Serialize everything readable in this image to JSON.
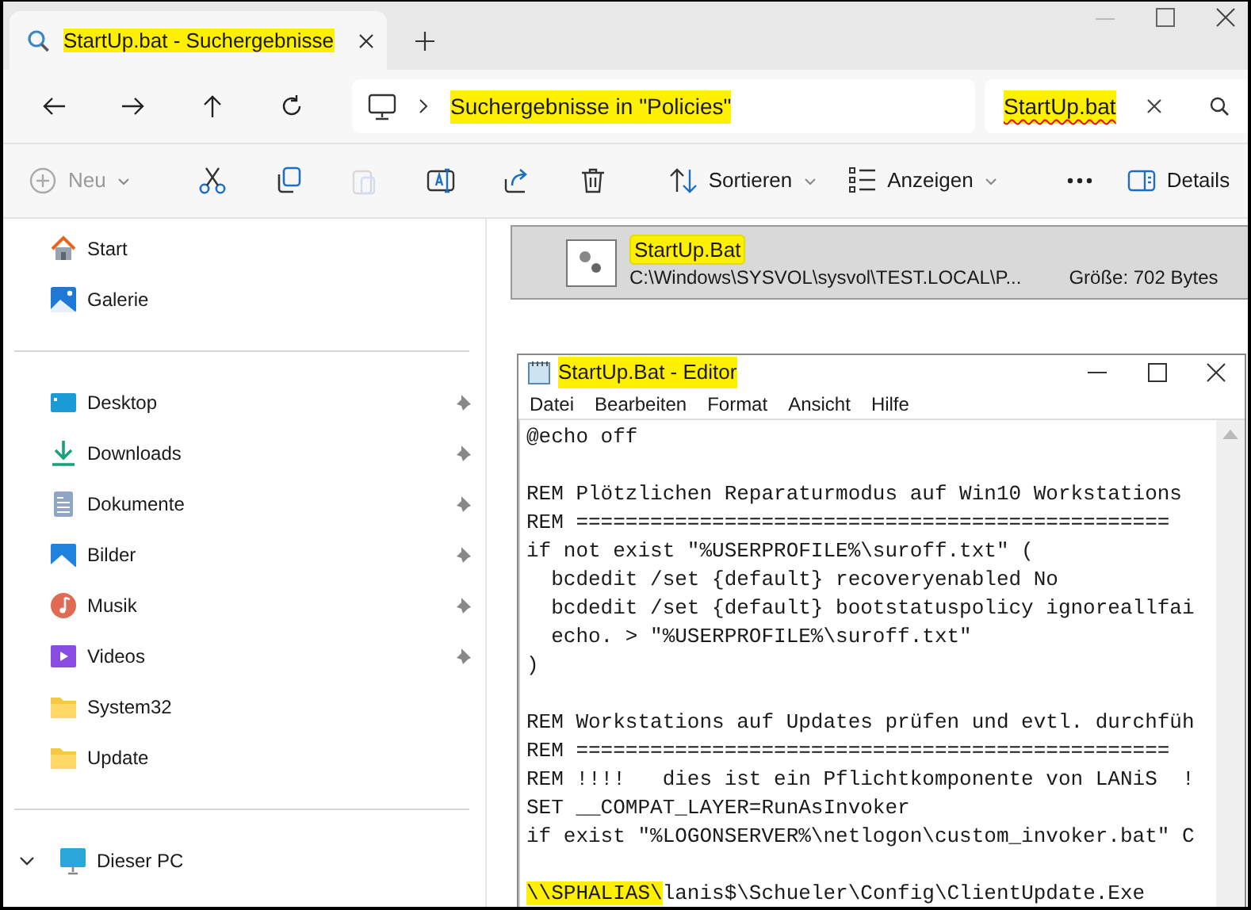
{
  "tab": {
    "title": "StartUp.bat - Suchergebnisse",
    "highlighted": true
  },
  "address_bar": {
    "path": "Suchergebnisse in \"Policies\"",
    "highlighted": true
  },
  "search": {
    "value": "StartUp.bat",
    "highlighted": true,
    "spellcheck_error": true
  },
  "toolbar": [
    {
      "kind": "menu",
      "label": "Neu",
      "disabled": true
    },
    {
      "kind": "separator"
    },
    {
      "kind": "icon",
      "disabled": false
    },
    {
      "kind": "icon",
      "disabled": false
    },
    {
      "kind": "icon",
      "disabled": true
    },
    {
      "kind": "icon",
      "disabled": false
    },
    {
      "kind": "icon",
      "disabled": false
    },
    {
      "kind": "icon",
      "disabled": false
    },
    {
      "kind": "separator"
    },
    {
      "kind": "menu",
      "label": "Sortieren",
      "disabled": false
    },
    {
      "kind": "menu",
      "label": "Anzeigen",
      "disabled": false
    },
    {
      "kind": "separator"
    },
    {
      "kind": "icon",
      "disabled": false
    },
    {
      "kind": "spacer"
    },
    {
      "kind": "button",
      "label": "Details",
      "disabled": false
    }
  ],
  "sidebar": {
    "groups": [
      [
        {
          "label": "Start",
          "pinned": false
        },
        {
          "label": "Galerie",
          "pinned": false
        }
      ],
      [
        {
          "label": "Desktop",
          "pinned": true
        },
        {
          "label": "Downloads",
          "pinned": true
        },
        {
          "label": "Dokumente",
          "pinned": true
        },
        {
          "label": "Bilder",
          "pinned": true
        },
        {
          "label": "Musik",
          "pinned": true
        },
        {
          "label": "Videos",
          "pinned": true
        },
        {
          "label": "System32",
          "pinned": false
        },
        {
          "label": "Update",
          "pinned": false
        }
      ],
      [
        {
          "label": "Dieser PC",
          "pinned": false,
          "expanded": true
        }
      ]
    ]
  },
  "results": [
    {
      "name": "StartUp.Bat",
      "name_highlighted": true,
      "path": "C:\\Windows\\SYSVOL\\sysvol\\TEST.LOCAL\\P...",
      "size": "Größe: 702 Bytes",
      "selected": true
    }
  ],
  "editor": {
    "title": "StartUp.Bat - Editor",
    "title_highlighted": true,
    "menu": [
      "Datei",
      "Bearbeiten",
      "Format",
      "Ansicht",
      "Hilfe"
    ],
    "lines": [
      {
        "kind": "code",
        "segments": [
          {
            "text": "@echo off",
            "highlighted": false
          }
        ]
      },
      {
        "kind": "blank"
      },
      {
        "kind": "code",
        "segments": [
          {
            "text": "REM Plötzlichen Reparaturmodus auf Win10 Workstations",
            "highlighted": false
          }
        ]
      },
      {
        "kind": "code",
        "segments": [
          {
            "text": "REM ================================================",
            "highlighted": false
          }
        ]
      },
      {
        "kind": "code",
        "segments": [
          {
            "text": "if not exist \"%USERPROFILE%\\suroff.txt\" (",
            "highlighted": false
          }
        ]
      },
      {
        "kind": "code",
        "segments": [
          {
            "text": "  bcdedit /set {default} recoveryenabled No",
            "highlighted": false
          }
        ]
      },
      {
        "kind": "code",
        "segments": [
          {
            "text": "  bcdedit /set {default} bootstatuspolicy ignoreallfai",
            "highlighted": false
          }
        ]
      },
      {
        "kind": "code",
        "segments": [
          {
            "text": "  echo. > \"%USERPROFILE%\\suroff.txt\"",
            "highlighted": false
          }
        ]
      },
      {
        "kind": "code",
        "segments": [
          {
            "text": ")",
            "highlighted": false
          }
        ]
      },
      {
        "kind": "blank"
      },
      {
        "kind": "code",
        "segments": [
          {
            "text": "REM Workstations auf Updates prüfen und evtl. durchfüh",
            "highlighted": false
          }
        ]
      },
      {
        "kind": "code",
        "segments": [
          {
            "text": "REM ================================================",
            "highlighted": false
          }
        ]
      },
      {
        "kind": "code",
        "segments": [
          {
            "text": "REM !!!!   dies ist ein Pflichtkomponente von LANiS  !",
            "highlighted": false
          }
        ]
      },
      {
        "kind": "code",
        "segments": [
          {
            "text": "SET __COMPAT_LAYER=RunAsInvoker",
            "highlighted": false
          }
        ]
      },
      {
        "kind": "code",
        "segments": [
          {
            "text": "if exist \"%LOGONSERVER%\\netlogon\\custom_invoker.bat\" C",
            "highlighted": false
          }
        ]
      },
      {
        "kind": "blank"
      },
      {
        "kind": "code",
        "segments": [
          {
            "text": "\\\\SPHALIAS\\",
            "highlighted": true
          },
          {
            "text": "lanis$\\Schueler\\Config\\ClientUpdate.Exe",
            "highlighted": false
          }
        ]
      }
    ]
  }
}
